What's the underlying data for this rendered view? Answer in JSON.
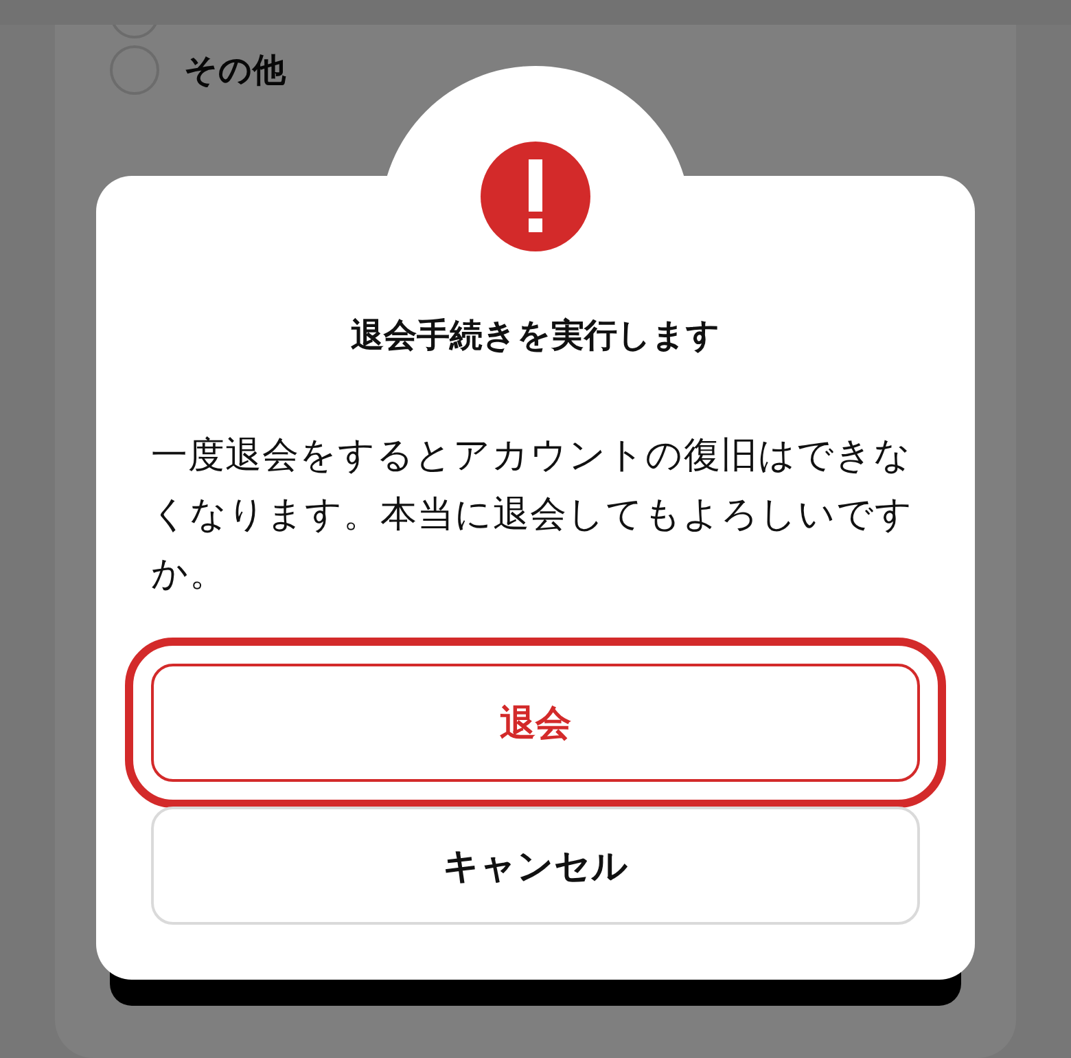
{
  "page": {
    "options": [
      {
        "selected": false
      },
      {
        "label": "その他",
        "selected": false
      }
    ]
  },
  "dialog": {
    "title": "退会手続きを実行します",
    "message": "一度退会をするとアカウントの復旧はできなくなります。本当に退会してもよろしいですか。",
    "buttons": [
      {
        "label": "退会",
        "kind": "danger",
        "focused": true
      },
      {
        "label": "キャンセル",
        "kind": "plain",
        "focused": false
      }
    ]
  }
}
